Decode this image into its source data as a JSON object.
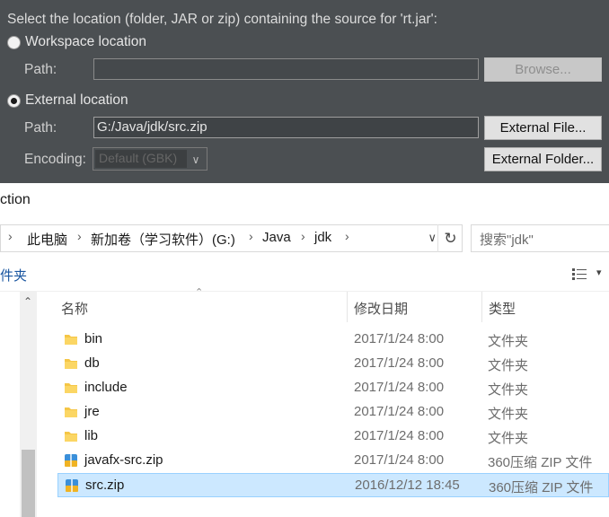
{
  "eclipse": {
    "prompt": "Select the location (folder, JAR or zip) containing the source for 'rt.jar':",
    "workspace_label": "Workspace location",
    "workspace_path_label": "Path:",
    "workspace_path_value": "",
    "browse_label": "Browse...",
    "external_label": "External location",
    "external_path_label": "Path:",
    "external_path_value": "G:/Java/jdk/src.zip",
    "external_file_label": "External File...",
    "encoding_label": "Encoding:",
    "encoding_value": "Default (GBK)",
    "external_folder_label": "External Folder..."
  },
  "explorer": {
    "title_fragment": "ction",
    "breadcrumb": [
      "此电脑",
      "新加卷（学习软件）(G:)",
      "Java",
      "jdk"
    ],
    "search_placeholder": "搜索\"jdk\"",
    "command_fragment": "件夹",
    "columns": {
      "name": "名称",
      "date": "修改日期",
      "type": "类型"
    },
    "files": [
      {
        "name": "bin",
        "date": "2017/1/24 8:00",
        "type": "文件夹",
        "icon": "folder-icon"
      },
      {
        "name": "db",
        "date": "2017/1/24 8:00",
        "type": "文件夹",
        "icon": "folder-icon"
      },
      {
        "name": "include",
        "date": "2017/1/24 8:00",
        "type": "文件夹",
        "icon": "folder-icon"
      },
      {
        "name": "jre",
        "date": "2017/1/24 8:00",
        "type": "文件夹",
        "icon": "folder-icon"
      },
      {
        "name": "lib",
        "date": "2017/1/24 8:00",
        "type": "文件夹",
        "icon": "folder-icon"
      },
      {
        "name": "javafx-src.zip",
        "date": "2017/1/24 8:00",
        "type": "360压缩 ZIP 文件",
        "icon": "zip-archive-icon"
      },
      {
        "name": "src.zip",
        "date": "2016/12/12 18:45",
        "type": "360压缩 ZIP 文件",
        "icon": "zip-archive-icon"
      }
    ]
  },
  "colors": {
    "dialog_bg": "#4b4f52",
    "selection_bg": "#cce8ff",
    "selection_border": "#99d1ff",
    "folder_yellow": "#f5c646"
  }
}
